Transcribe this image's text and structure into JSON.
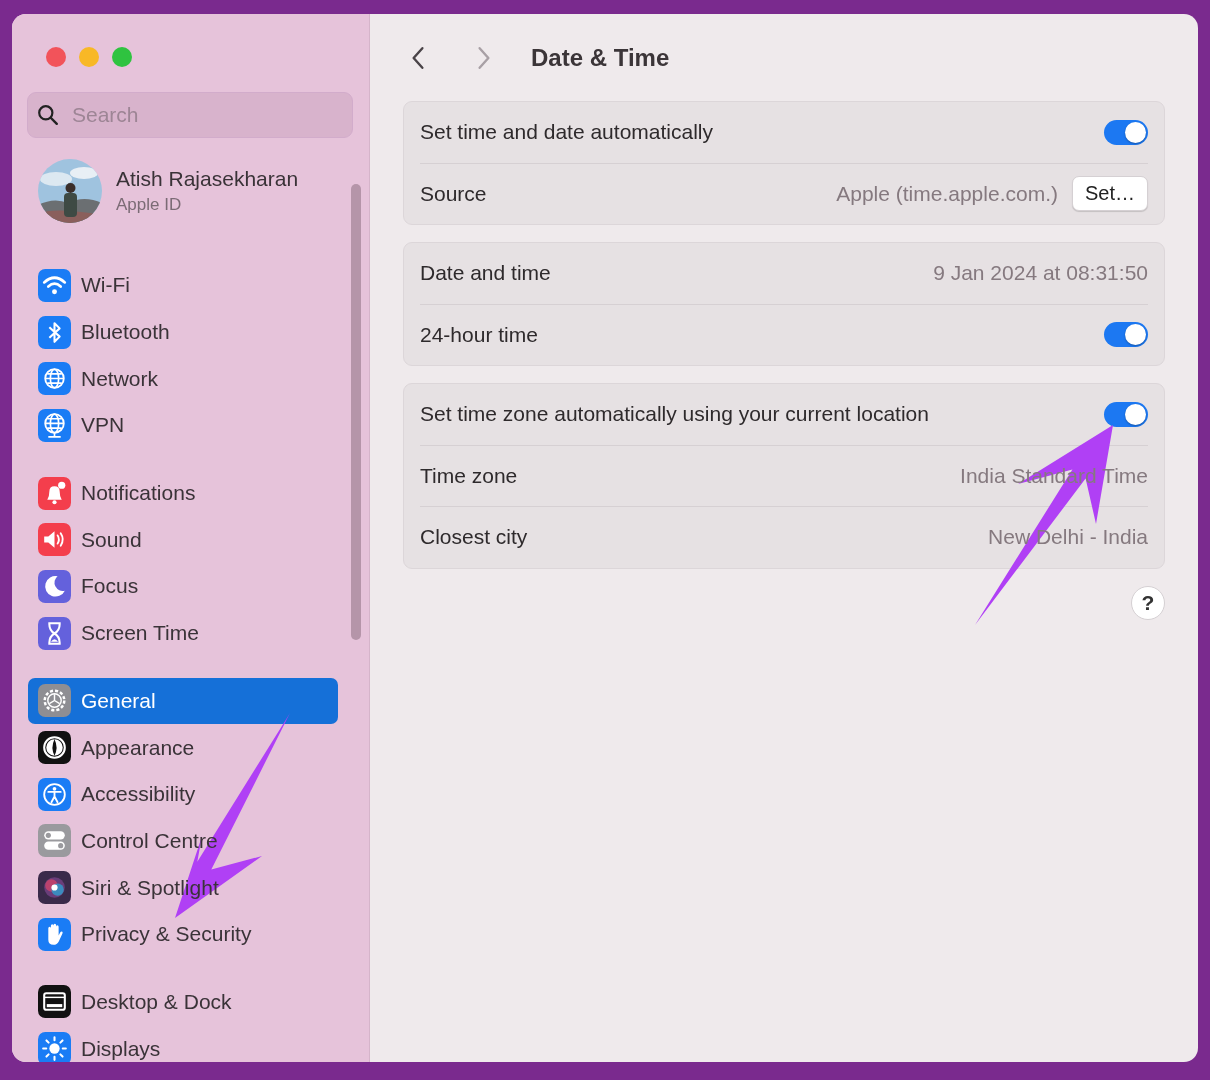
{
  "sidebar": {
    "search": {
      "placeholder": "Search"
    },
    "account": {
      "name": "Atish Rajasekharan",
      "subtitle": "Apple ID"
    },
    "groups": [
      [
        {
          "label": "Wi-Fi",
          "selected": false
        },
        {
          "label": "Bluetooth",
          "selected": false
        },
        {
          "label": "Network",
          "selected": false
        },
        {
          "label": "VPN",
          "selected": false
        }
      ],
      [
        {
          "label": "Notifications",
          "selected": false
        },
        {
          "label": "Sound",
          "selected": false
        },
        {
          "label": "Focus",
          "selected": false
        },
        {
          "label": "Screen Time",
          "selected": false
        }
      ],
      [
        {
          "label": "General",
          "selected": true
        },
        {
          "label": "Appearance",
          "selected": false
        },
        {
          "label": "Accessibility",
          "selected": false
        },
        {
          "label": "Control Centre",
          "selected": false
        },
        {
          "label": "Siri & Spotlight",
          "selected": false
        },
        {
          "label": "Privacy & Security",
          "selected": false
        }
      ],
      [
        {
          "label": "Desktop & Dock",
          "selected": false
        },
        {
          "label": "Displays",
          "selected": false
        }
      ]
    ]
  },
  "content": {
    "title": "Date & Time",
    "nav": {
      "back_disabled": false,
      "forward_disabled": true
    },
    "sections": [
      [
        {
          "kind": "toggle",
          "label": "Set time and date automatically",
          "on": true
        },
        {
          "kind": "value_button",
          "label": "Source",
          "value": "Apple (time.apple.com.)",
          "button": "Set…"
        }
      ],
      [
        {
          "kind": "value",
          "label": "Date and time",
          "value": "9 Jan 2024 at 08:31:50"
        },
        {
          "kind": "toggle",
          "label": "24-hour time",
          "on": true
        }
      ],
      [
        {
          "kind": "toggle",
          "label": "Set time zone automatically using your current location",
          "on": true
        },
        {
          "kind": "value",
          "label": "Time zone",
          "value": "India Standard Time"
        },
        {
          "kind": "value",
          "label": "Closest city",
          "value": "New Delhi - India"
        }
      ]
    ],
    "help": "?"
  }
}
